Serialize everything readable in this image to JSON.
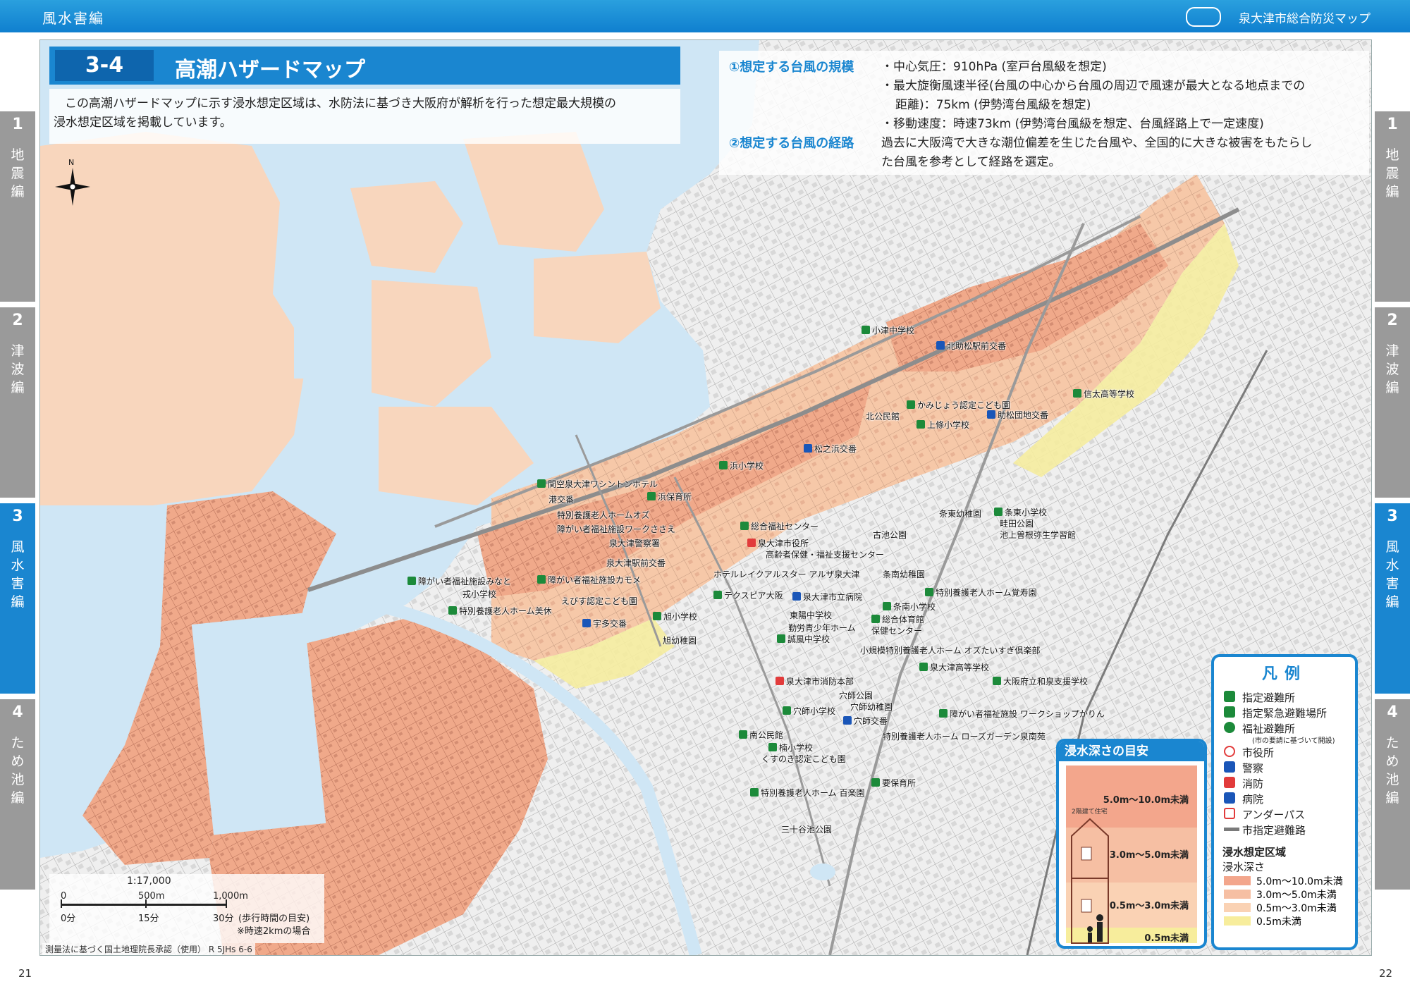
{
  "header": {
    "section": "風水害編",
    "brand": "泉大津市総合防災マップ"
  },
  "title": {
    "code": "3-4",
    "text": "高潮ハザードマップ"
  },
  "intro": {
    "line1": "この高潮ハザードマップに示す浸水想定区域は、水防法に基づき大阪府が解析を行った想定最大規模の",
    "line2": "浸水想定区域を掲載しています。"
  },
  "typhoon": {
    "scale_heading": "①想定する台風の規模",
    "scale_lines": [
      "・中心気圧：910hPa (室戸台風級を想定)",
      "・最大旋衡風速半径(台風の中心から台風の周辺で風速が最大となる地点までの",
      "距離)：75km (伊勢湾台風級を想定)",
      "・移動速度：時速73km (伊勢湾台風級を想定、台風経路上で一定速度)"
    ],
    "route_heading": "②想定する台風の経路",
    "route_lines": [
      "過去に大阪湾で大きな潮位偏差を生じた台風や、全国的に大きな被害をもたらし",
      "た台風を参考として経路を選定。"
    ]
  },
  "side_tabs": [
    {
      "num": "1",
      "label": "地震編",
      "side": "both"
    },
    {
      "num": "2",
      "label": "津波編",
      "side": "both"
    },
    {
      "num": "3",
      "label": "風水害編",
      "side": "both",
      "active": true
    },
    {
      "num": "4",
      "label": "ため池編",
      "side": "both"
    }
  ],
  "legend": {
    "title": "凡例",
    "items": [
      {
        "label": "指定避難所",
        "color": "#1c8a3a"
      },
      {
        "label": "指定緊急避難場所",
        "color": "#1c8a3a"
      },
      {
        "label": "福祉避難所",
        "color": "#1c8a3a",
        "note": "(市の要請に基づいて開設)"
      },
      {
        "label": "市役所",
        "color": "#e23b3b"
      },
      {
        "label": "警察",
        "color": "#1a56b8"
      },
      {
        "label": "消防",
        "color": "#e23b3b"
      },
      {
        "label": "病院",
        "color": "#1a56b8"
      },
      {
        "label": "アンダーパス",
        "color": "#e23b3b"
      },
      {
        "label": "市指定避難路",
        "color": "#7a7a7a"
      }
    ],
    "area_title": "浸水想定区域",
    "depth_title": "浸水深さ",
    "depths": [
      {
        "label": "5.0m～10.0m未満",
        "color": "#f3a68c"
      },
      {
        "label": "3.0m～5.0m未満",
        "color": "#f6bfa3"
      },
      {
        "label": "0.5m～3.0m未満",
        "color": "#fad2b4"
      },
      {
        "label": "0.5m未満",
        "color": "#f7ed9c"
      }
    ]
  },
  "depth_guide": {
    "title": "浸水深さの目安",
    "house_label": "2階建て住宅",
    "bands": [
      {
        "label": "5.0m～10.0m未満",
        "color": "#f3a68c"
      },
      {
        "label": "3.0m～5.0m未満",
        "color": "#f6bfa3"
      },
      {
        "label": "0.5m～3.0m未満",
        "color": "#fad2b4"
      },
      {
        "label": "0.5m未満",
        "color": "#f7ed9c"
      }
    ]
  },
  "scale": {
    "ratio": "1:17,000",
    "d0": "0",
    "d1": "500m",
    "d2": "1,000m",
    "t0": "0分",
    "t1": "15分",
    "t2": "30分",
    "walk": "(歩行時間の目安)",
    "speed": "※時速2kmの場合"
  },
  "credit": "測量法に基づく国土地理院長承認（使用） R 5JHs 6-6",
  "pages": {
    "left": "21",
    "right": "22"
  },
  "map_labels": [
    {
      "text": "小津中学校"
    },
    {
      "text": "北助松駅前交番"
    },
    {
      "text": "信太高等学校"
    },
    {
      "text": "かみじょう認定こども園"
    },
    {
      "text": "北公民館"
    },
    {
      "text": "上條小学校"
    },
    {
      "text": "助松団地交番"
    },
    {
      "text": "浜小学校"
    },
    {
      "text": "松之浜交番"
    },
    {
      "text": "関空泉大津ワシントンホテル"
    },
    {
      "text": "港交番"
    },
    {
      "text": "浜保育所"
    },
    {
      "text": "特別養護老人ホームオズ"
    },
    {
      "text": "障がい者福祉施設ワークささえ"
    },
    {
      "text": "泉大津警察署"
    },
    {
      "text": "泉大津駅前交番"
    },
    {
      "text": "総合福祉センター"
    },
    {
      "text": "泉大津市役所"
    },
    {
      "text": "高齢者保健・福祉支援センター"
    },
    {
      "text": "古池公園"
    },
    {
      "text": "条東幼稚園"
    },
    {
      "text": "条東小学校"
    },
    {
      "text": "畦田公園"
    },
    {
      "text": "池上曽根弥生学習館"
    },
    {
      "text": "障がい者福祉施設みなと"
    },
    {
      "text": "障がい者福祉施設カモメ"
    },
    {
      "text": "戎小学校"
    },
    {
      "text": "えびす認定こども園"
    },
    {
      "text": "特別養護老人ホーム美休"
    },
    {
      "text": "ホテルレイクアルスター アルザ泉大津"
    },
    {
      "text": "条南幼稚園"
    },
    {
      "text": "テクスピア大阪"
    },
    {
      "text": "泉大津市立病院"
    },
    {
      "text": "条南小学校"
    },
    {
      "text": "特別養護老人ホーム覚寿園"
    },
    {
      "text": "宇多交番"
    },
    {
      "text": "旭小学校"
    },
    {
      "text": "東陽中学校"
    },
    {
      "text": "総合体育館"
    },
    {
      "text": "勤労青少年ホーム"
    },
    {
      "text": "保健センター"
    },
    {
      "text": "旭幼稚園"
    },
    {
      "text": "誠風中学校"
    },
    {
      "text": "小規模特別養護老人ホーム オズたいすぎ倶楽部"
    },
    {
      "text": "泉大津高等学校"
    },
    {
      "text": "泉大津市消防本部"
    },
    {
      "text": "大阪府立和泉支援学校"
    },
    {
      "text": "穴師公園"
    },
    {
      "text": "穴師幼稚園"
    },
    {
      "text": "穴師小学校"
    },
    {
      "text": "穴師交番"
    },
    {
      "text": "障がい者福祉施設 ワークショップかりん"
    },
    {
      "text": "南公民館"
    },
    {
      "text": "楠小学校"
    },
    {
      "text": "特別養護老人ホーム ローズガーデン泉南苑"
    },
    {
      "text": "くすのき認定こども園"
    },
    {
      "text": "要保育所"
    },
    {
      "text": "特別養護老人ホーム 百楽園"
    },
    {
      "text": "三十谷池公園"
    }
  ]
}
